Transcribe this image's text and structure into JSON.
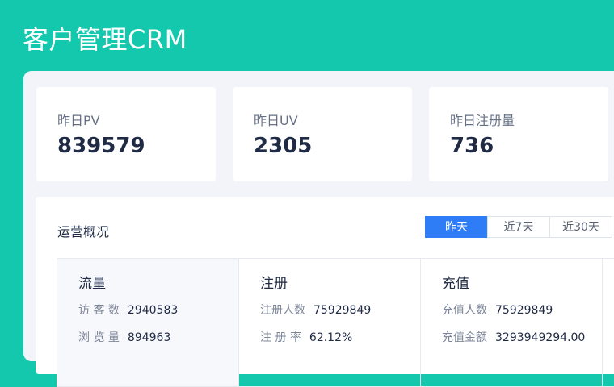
{
  "app": {
    "title": "客户管理CRM"
  },
  "stats": [
    {
      "label": "昨日PV",
      "value": "839579"
    },
    {
      "label": "昨日UV",
      "value": "2305"
    },
    {
      "label": "昨日注册量",
      "value": "736"
    }
  ],
  "ops": {
    "title": "运营概况",
    "tabs": [
      "昨天",
      "近7天",
      "近30天"
    ],
    "active_tab": "昨天",
    "sections": [
      {
        "title": "流量",
        "rows": [
          {
            "label": "访 客 数",
            "value": "2940583"
          },
          {
            "label": "浏 览 量",
            "value": "894963"
          }
        ]
      },
      {
        "title": "注册",
        "rows": [
          {
            "label": "注册人数",
            "value": "75929849"
          },
          {
            "label": "注 册 率",
            "value": "62.12%"
          }
        ]
      },
      {
        "title": "充值",
        "rows": [
          {
            "label": "充值人数",
            "value": "75929849"
          },
          {
            "label": "充值金额",
            "value": "3293949294.00"
          }
        ]
      }
    ]
  },
  "colors": {
    "brand": "#13c8ad",
    "accent": "#2f7df6"
  }
}
